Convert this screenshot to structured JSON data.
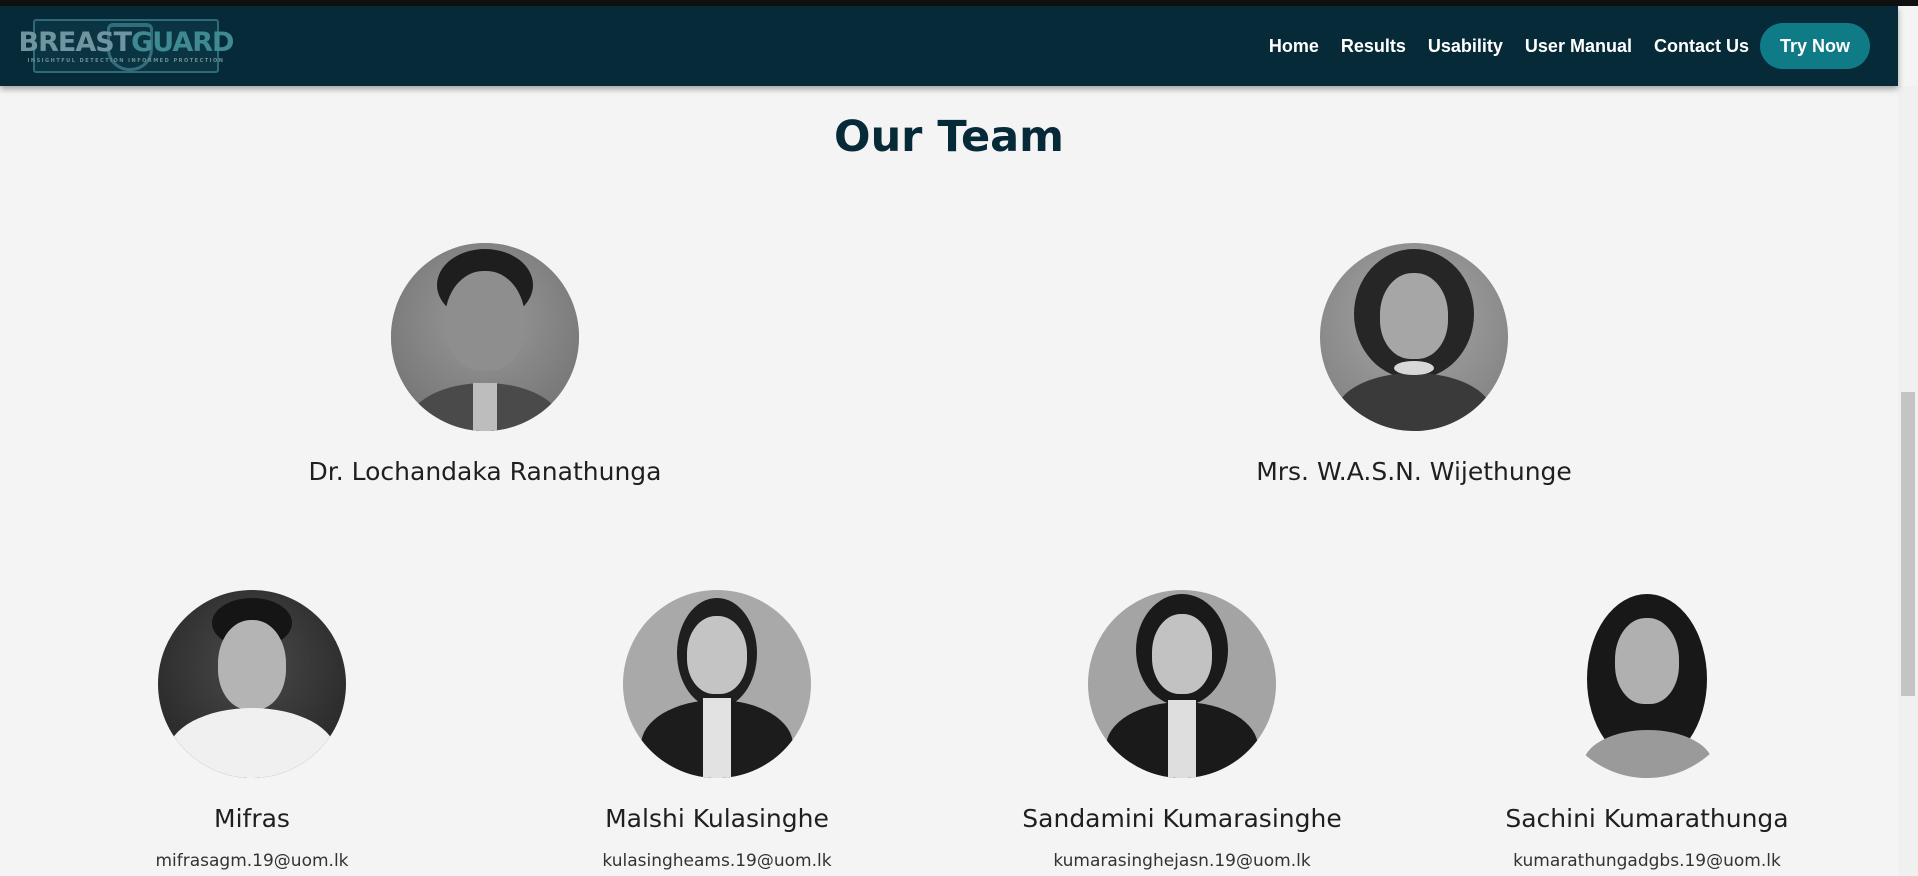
{
  "brand": {
    "logo_part1": "BREAST",
    "logo_part2": "GUARD",
    "logo_tagline": "INSIGHTFUL DETECTION   INFORMED PROTECTION"
  },
  "nav": {
    "links": [
      "Home",
      "Results",
      "Usability",
      "User Manual",
      "Contact Us"
    ],
    "cta": "Try Now"
  },
  "section": {
    "title": "Our Team"
  },
  "supervisors": [
    {
      "name": "Dr. Lochandaka Ranathunga"
    },
    {
      "name": "Mrs. W.A.S.N. Wijethunge"
    }
  ],
  "members": [
    {
      "name": "Mifras",
      "email": "mifrasagm.19@uom.lk"
    },
    {
      "name": "Malshi Kulasinghe",
      "email": "kulasingheams.19@uom.lk"
    },
    {
      "name": "Sandamini Kumarasinghe",
      "email": "kumarasinghejasn.19@uom.lk"
    },
    {
      "name": "Sachini Kumarathunga",
      "email": "kumarathungadgbs.19@uom.lk"
    }
  ],
  "colors": {
    "navbar_bg": "#062a38",
    "cta_bg": "#0f7b86",
    "heading": "#062a38",
    "page_bg": "#f4f4f4"
  }
}
